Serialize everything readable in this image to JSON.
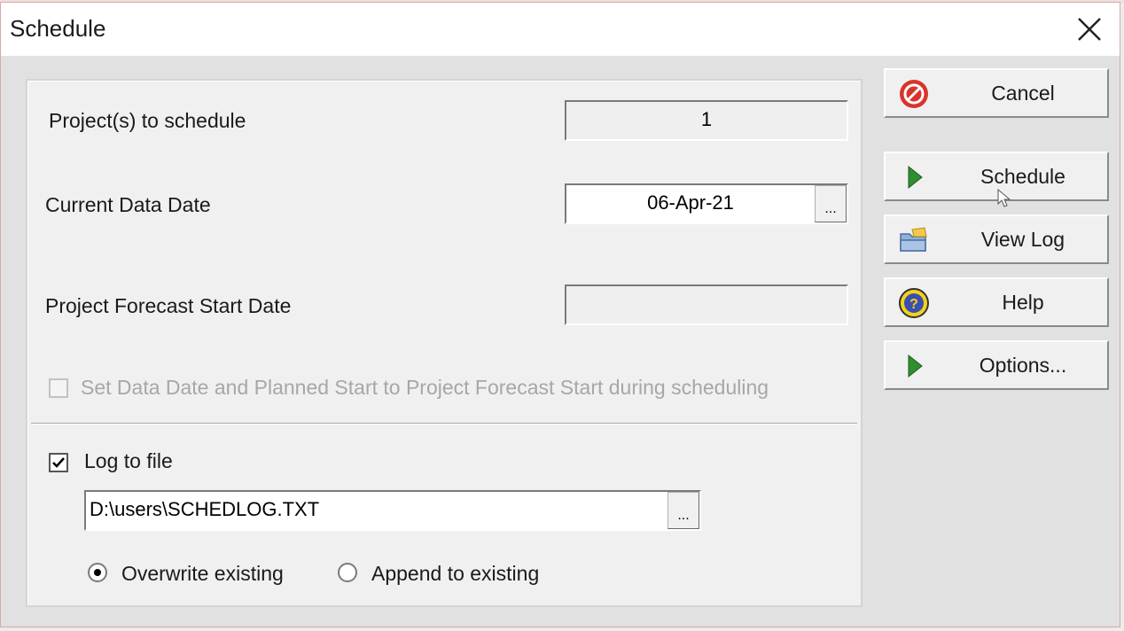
{
  "window": {
    "title": "Schedule"
  },
  "form": {
    "projects_label": "Project(s) to schedule",
    "projects_value": "1",
    "data_date_label": "Current Data Date",
    "data_date_value": "06-Apr-21",
    "forecast_label": "Project Forecast Start Date",
    "forecast_value": "",
    "set_data_date_label": "Set Data Date and Planned Start to Project Forecast Start during scheduling",
    "set_data_date_checked": false,
    "ellipsis": "..."
  },
  "log": {
    "log_to_file_label": "Log to file",
    "log_to_file_checked": true,
    "path": "D:\\users\\SCHEDLOG.TXT",
    "overwrite_label": "Overwrite existing",
    "append_label": "Append to existing",
    "selected_mode": "overwrite"
  },
  "buttons": {
    "cancel": "Cancel",
    "schedule": "Schedule",
    "view_log": "View Log",
    "help": "Help",
    "options": "Options..."
  },
  "icons": {
    "cancel": "no-entry-icon",
    "schedule": "play-arrow-icon",
    "view_log": "open-folder-icon",
    "help": "question-mark-icon",
    "options": "play-arrow-icon"
  },
  "colors": {
    "cancel_icon": "#d9342b",
    "play_icon": "#2f8f2f",
    "help_icon": "#f3d21a"
  }
}
